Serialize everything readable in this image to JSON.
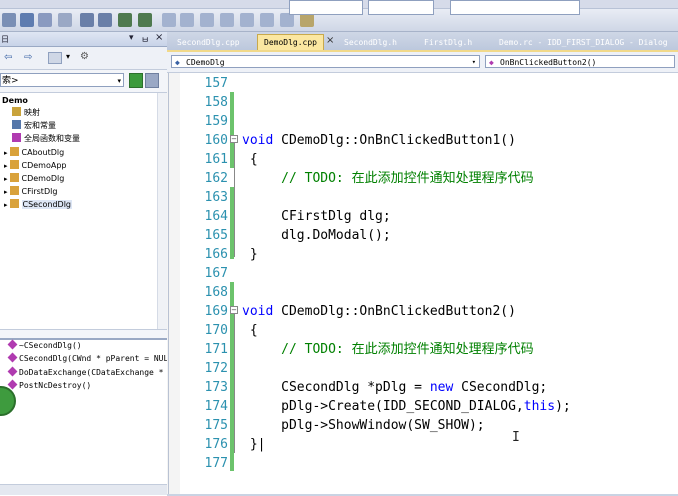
{
  "toolbar": {
    "solution_platform": "",
    "find_value": ""
  },
  "left_panel": {
    "search_placeholder": "索>",
    "tree_items": [
      {
        "label": "Demo",
        "bold": true
      },
      {
        "label": "映射"
      },
      {
        "label": "宏和常量"
      },
      {
        "label": "全局函数和变量"
      },
      {
        "label": "CAboutDlg"
      },
      {
        "label": "CDemoApp"
      },
      {
        "label": "CDemoDlg"
      },
      {
        "label": "CFirstDlg"
      },
      {
        "label": "CSecondDlg",
        "selected": true
      }
    ],
    "members": [
      "~CSecondDlg()",
      "CSecondDlg(CWnd * pParent = NULL",
      "DoDataExchange(CDataExchange * p",
      "PostNcDestroy()"
    ]
  },
  "tabs": [
    {
      "label": "SecondDlg.cpp",
      "active": false
    },
    {
      "label": "DemoDlg.cpp",
      "active": true
    },
    {
      "label": "SecondDlg.h",
      "active": false
    },
    {
      "label": "FirstDlg.h",
      "active": false
    },
    {
      "label": "Demo.rc - IDD_FIRST_DIALOG - Dialog",
      "active": false
    }
  ],
  "nav": {
    "class_combo": "CDemoDlg",
    "member_combo": "OnBnClickedButton2()"
  },
  "code_lines": [
    {
      "num": "157",
      "text": ""
    },
    {
      "num": "158",
      "text": ""
    },
    {
      "num": "159",
      "text": ""
    },
    {
      "num": "160",
      "kw": "void",
      "text": " CDemoDlg::OnBnClickedButton1()"
    },
    {
      "num": "161",
      "text": " {"
    },
    {
      "num": "162",
      "comment": "     // TODO: 在此添加控件通知处理程序代码"
    },
    {
      "num": "163",
      "text": ""
    },
    {
      "num": "164",
      "text": "     CFirstDlg dlg;"
    },
    {
      "num": "165",
      "text": "     dlg.DoModal();"
    },
    {
      "num": "166",
      "text": " }"
    },
    {
      "num": "167",
      "text": ""
    },
    {
      "num": "168",
      "text": ""
    },
    {
      "num": "169",
      "kw": "void",
      "text": " CDemoDlg::OnBnClickedButton2()"
    },
    {
      "num": "170",
      "text": " {"
    },
    {
      "num": "171",
      "comment": "     // TODO: 在此添加控件通知处理程序代码"
    },
    {
      "num": "172",
      "text": ""
    },
    {
      "num": "173",
      "pre": "     CSecondDlg *pDlg = ",
      "kw": "new",
      "text": " CSecondDlg;"
    },
    {
      "num": "174",
      "pre": "     pDlg->Create(IDD_SECOND_DIALOG,",
      "kw": "this",
      "text": ");"
    },
    {
      "num": "175",
      "text": "     pDlg->ShowWindow(SW_SHOW);"
    },
    {
      "num": "176",
      "text": " }|"
    },
    {
      "num": "177",
      "text": ""
    }
  ],
  "colors": {
    "keyword": "#0000ff",
    "comment": "#008000",
    "line_number": "#2b91af",
    "active_tab": "#fbe7a1",
    "change_bar": "#6cc36c"
  },
  "icons": [
    "pin-icon",
    "close-icon",
    "back-arrow-icon",
    "forward-arrow-icon",
    "go-icon",
    "class-icon",
    "method-icon",
    "text-cursor-icon"
  ]
}
